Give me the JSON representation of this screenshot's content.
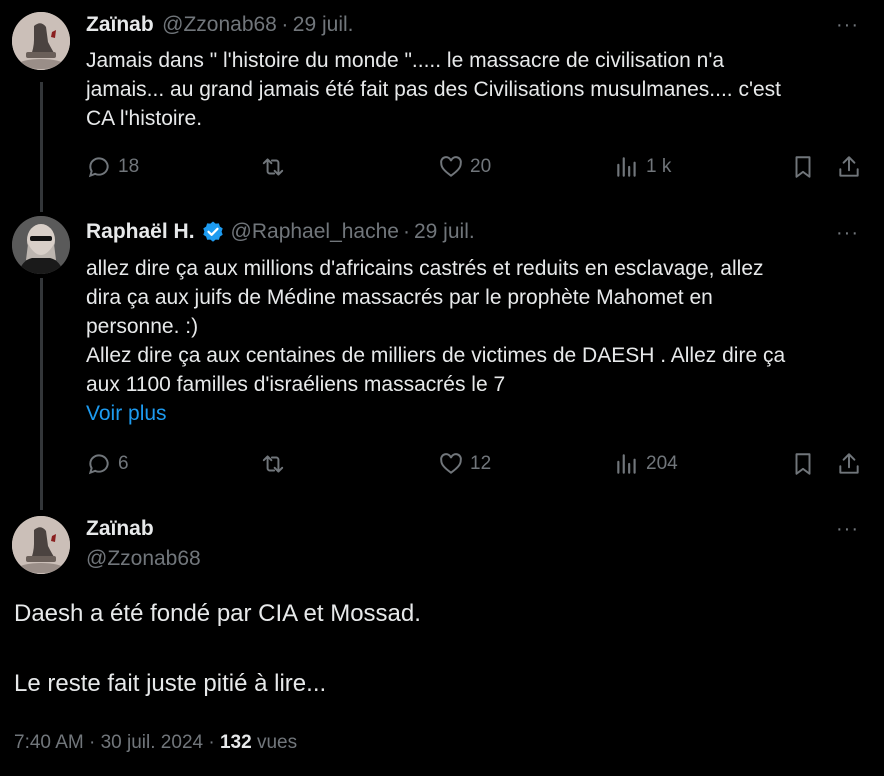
{
  "colors": {
    "background": "#000000",
    "text": "#e7e9ea",
    "muted": "#71767b",
    "link": "#1d9bf0",
    "verified": "#1d9bf0"
  },
  "tweet1": {
    "name": "Zaïnab",
    "handle": "@Zzonab68",
    "date": "29 juil.",
    "text": [
      "Jamais dans \" l'histoire du monde \"..... le massacre de civilisation n'a",
      "jamais... au grand jamais été fait pas des Civilisations musulmanes.... c'est",
      "CA l'histoire."
    ],
    "actions": {
      "replies": "18",
      "reposts": "",
      "likes": "20",
      "views": "1 k"
    }
  },
  "tweet2": {
    "name": "Raphaël H.",
    "handle": "@Raphael_hache",
    "date": "29 juil.",
    "text": [
      "allez dire ça aux millions d'africains castrés et reduits en esclavage, allez",
      "dira ça aux juifs de Médine massacrés par le prophète Mahomet en",
      "personne. :)",
      "Allez dire ça aux centaines de milliers de victimes de DAESH . Allez dire ça",
      "aux 1100 familles d'israéliens massacrés le 7"
    ],
    "show_more": "Voir plus",
    "actions": {
      "replies": "6",
      "reposts": "",
      "likes": "12",
      "views": "204"
    }
  },
  "main_tweet": {
    "name": "Zaïnab",
    "handle": "@Zzonab68",
    "text": [
      "Daesh a été fondé par CIA et Mossad.",
      "Le reste fait juste pitié à lire..."
    ],
    "time": "7:40 AM",
    "date": "30 juil. 2024",
    "views_count": "132",
    "views_label": "vues"
  },
  "icons": {
    "reply": "reply-icon",
    "repost": "repost-icon",
    "like": "heart-icon",
    "views": "views-icon",
    "bookmark": "bookmark-icon",
    "share": "share-icon",
    "more": "more-icon",
    "verified": "verified-badge-icon"
  },
  "more_label": "···",
  "separator": "·"
}
